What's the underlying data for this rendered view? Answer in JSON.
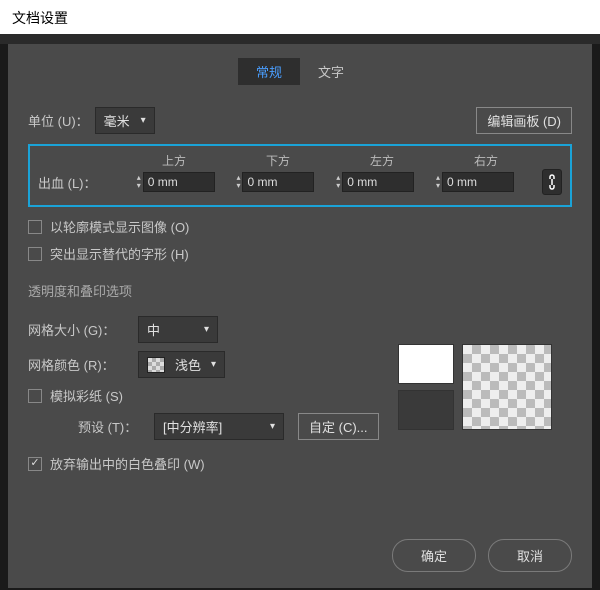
{
  "title": "文档设置",
  "tabs": {
    "general": "常规",
    "text": "文字"
  },
  "units": {
    "label": "单位 (U)：",
    "value": "毫米"
  },
  "edit_artboard": "编辑画板 (D)",
  "bleed": {
    "label": "出血 (L)：",
    "headers": {
      "top": "上方",
      "bottom": "下方",
      "left": "左方",
      "right": "右方"
    },
    "values": {
      "top": "0 mm",
      "bottom": "0 mm",
      "left": "0 mm",
      "right": "0 mm"
    }
  },
  "checkboxes": {
    "outline_mode": "以轮廓模式显示图像 (O)",
    "highlight_glyphs": "突出显示替代的字形 (H)",
    "simulate_paper": "模拟彩纸 (S)",
    "discard_overprint": "放弃输出中的白色叠印 (W)"
  },
  "transparency_title": "透明度和叠印选项",
  "grid_size": {
    "label": "网格大小 (G)：",
    "value": "中"
  },
  "grid_color": {
    "label": "网格颜色 (R)：",
    "value": "浅色"
  },
  "preset": {
    "label": "预设 (T)：",
    "value": "[中分辨率]",
    "custom": "自定 (C)..."
  },
  "footer": {
    "ok": "确定",
    "cancel": "取消"
  }
}
